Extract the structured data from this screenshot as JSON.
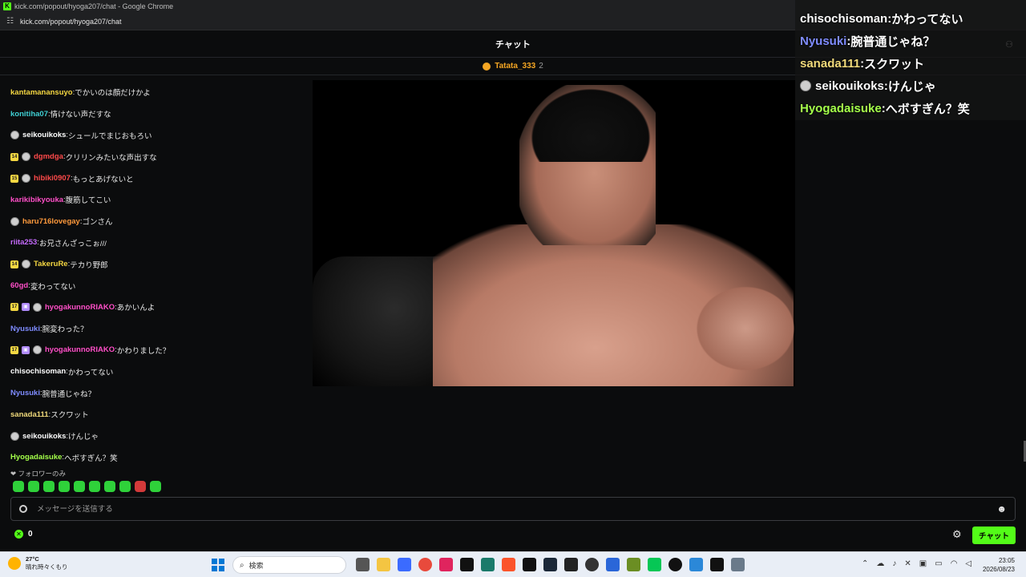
{
  "window": {
    "title": "kick.com/popout/hyoga207/chat - Google Chrome",
    "url": "kick.com/popout/hyoga207/chat"
  },
  "header": {
    "title": "チャット"
  },
  "pinned": {
    "user": "Tatata_333",
    "count": "2"
  },
  "messages": [
    {
      "user": "kantamanansuyo",
      "color": "#f5d742",
      "text": "でかいのは顔だけかよ",
      "badges": []
    },
    {
      "user": "konitiha07",
      "color": "#3fd0d4",
      "text": "情けない声だすな",
      "badges": []
    },
    {
      "user": "seikouikoks",
      "color": "#ffffff",
      "text": "シュールでまじおもろい",
      "badges": [
        "avatar"
      ]
    },
    {
      "user": "dgmdga",
      "color": "#ff4a4a",
      "text": "クリリンみたいな声出すな",
      "badges": [
        "sub",
        "avatar"
      ],
      "sub": "14"
    },
    {
      "user": "hibiki0907",
      "color": "#ff4a4a",
      "text": "もっとあげないと",
      "badges": [
        "sub",
        "avatar"
      ],
      "sub": "15"
    },
    {
      "user": "karikibikyouka",
      "color": "#ff4fc8",
      "text": "腹筋してこい",
      "badges": []
    },
    {
      "user": "haru716lovegay",
      "color": "#ff9a3c",
      "text": "ゴンさん",
      "badges": [
        "avatar"
      ]
    },
    {
      "user": "riita253",
      "color": "#c76bff",
      "text": "お兄さんざっこぉ///",
      "badges": []
    },
    {
      "user": "TakeruRe",
      "color": "#f5d742",
      "text": "テカり野郎",
      "badges": [
        "sub",
        "avatar"
      ],
      "sub": "14"
    },
    {
      "user": "60gd",
      "color": "#ff4fc8",
      "text": "変わってない",
      "badges": []
    },
    {
      "user": "hyogakunnoRIAKO",
      "color": "#ff4fc8",
      "text": "あかいんよ",
      "badges": [
        "sub",
        "gift",
        "avatar"
      ],
      "sub": "17"
    },
    {
      "user": "Nyusuki",
      "color": "#7f8cff",
      "text": "腕変わった？",
      "badges": []
    },
    {
      "user": "hyogakunnoRIAKO",
      "color": "#ff4fc8",
      "text": "かわりました？",
      "badges": [
        "sub",
        "gift",
        "avatar"
      ],
      "sub": "17"
    },
    {
      "user": "chisochisoman",
      "color": "#ffffff",
      "text": "かわってない",
      "badges": []
    },
    {
      "user": "Nyusuki",
      "color": "#7f8cff",
      "text": "腕普通じゃね？",
      "badges": []
    },
    {
      "user": "sanada111",
      "color": "#f0d97a",
      "text": "スクワット",
      "badges": []
    },
    {
      "user": "seikouikoks",
      "color": "#ffffff",
      "text": "けんじゃ",
      "badges": [
        "avatar"
      ]
    },
    {
      "user": "Hyogadaisuke",
      "color": "#a4ff4a",
      "text": "へボすぎん？笑",
      "badges": []
    }
  ],
  "overlay_chat": [
    {
      "user": "chisochisoman",
      "color": "#ffffff",
      "text": "かわってない",
      "avatar": false
    },
    {
      "user": "Nyusuki",
      "color": "#7f8cff",
      "text": "腕普通じゃね？",
      "avatar": false
    },
    {
      "user": "sanada111",
      "color": "#f0d97a",
      "text": "スクワット",
      "avatar": false
    },
    {
      "user": "seikouikoks",
      "color": "#ffffff",
      "text": "けんじゃ",
      "avatar": true
    },
    {
      "user": "Hyogadaisuke",
      "color": "#a4ff4a",
      "text": "へボすぎん？笑",
      "avatar": false
    }
  ],
  "follower_note": "フォロワーのみ",
  "emotes": [
    "emote-1",
    "emote-2",
    "emote-3",
    "emote-4",
    "emote-5",
    "emote-6",
    "emote-7",
    "emote-8",
    "emote-9",
    "emote-10"
  ],
  "input": {
    "placeholder": "メッセージを送信する"
  },
  "points": {
    "value": "0"
  },
  "send_button": "チャット",
  "taskbar": {
    "weather_temp": "27°C",
    "weather_desc": "晴れ時々くもり",
    "weather_alert": "2",
    "search_placeholder": "検索",
    "time": "23:05",
    "date": "2026/08/23"
  },
  "colors": {
    "accent": "#53fc18",
    "background": "#0b0c0d"
  }
}
